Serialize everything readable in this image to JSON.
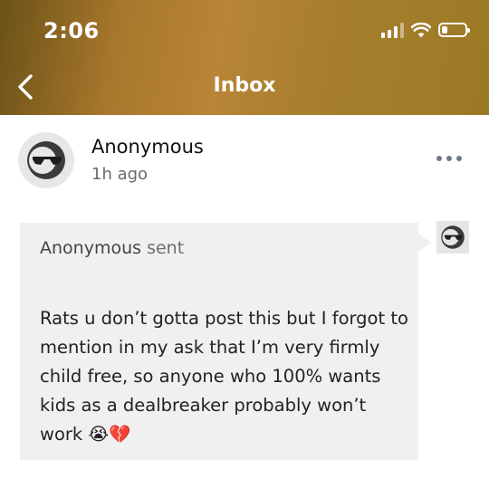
{
  "status_bar": {
    "time": "2:06"
  },
  "header": {
    "title": "Inbox"
  },
  "sender": {
    "name": "Anonymous",
    "time": "1h ago"
  },
  "message": {
    "sender_label": "Anonymous",
    "sent_suffix": "sent",
    "text": "Rats u don’t gotta post this but I forgot to mention in my ask that I’m very firmly child free, so anyone who 100% wants kids as a dealbreaker probably won’t work 😭💔"
  }
}
